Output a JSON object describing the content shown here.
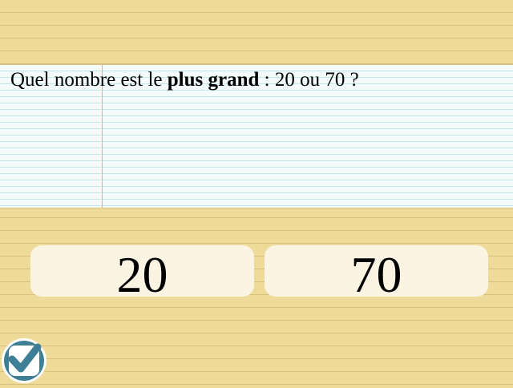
{
  "question": {
    "prefix": "Quel nombre est le ",
    "emphasis": "plus grand",
    "suffix": " : 20 ou 70 ?"
  },
  "answers": [
    {
      "label": "20"
    },
    {
      "label": "70"
    }
  ],
  "validate_button": {
    "icon": "checkmark-icon",
    "colors": {
      "ring": "#ffffff",
      "fill": "#3f7f96",
      "check": "#ffffff"
    }
  },
  "colors": {
    "background": "#eedb99",
    "background_lines": "#d9c07f",
    "paper": "#f3fbfb",
    "paper_lines": "#c9e7ea",
    "margin_line": "#f0a5a5",
    "answer_card": "#fbf4e2"
  }
}
